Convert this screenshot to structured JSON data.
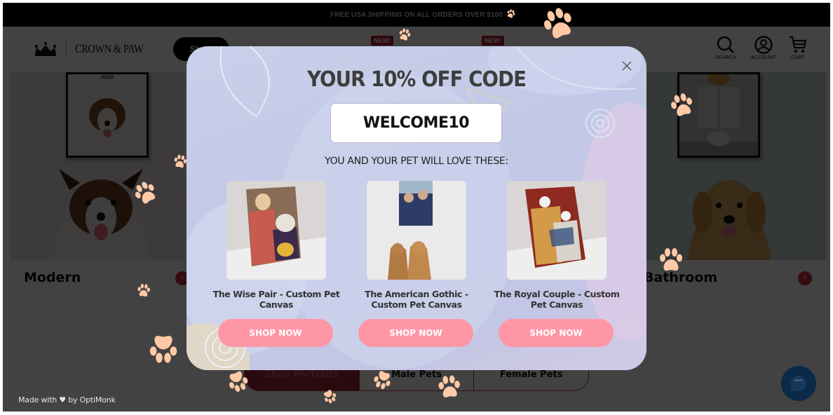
{
  "announcement": "FREE USA SHIPPING ON ALL ORDERS OVER $100",
  "brand": {
    "name": "CROWN & PAW"
  },
  "header": {
    "shop_button": "Sh",
    "badges": [
      "NEW!",
      "NEW!"
    ],
    "icons": [
      {
        "icon": "search-icon",
        "label": "SEARCH"
      },
      {
        "icon": "account-icon",
        "label": "ACCOUNT"
      },
      {
        "icon": "cart-icon",
        "label": "CART"
      }
    ]
  },
  "categories": [
    {
      "title": "Modern",
      "pet_name": "BENJI"
    },
    {
      "title": "Bathroom"
    }
  ],
  "tabs": [
    {
      "label": "Shop Portraits",
      "active": true
    },
    {
      "label": "Male Pets",
      "active": false
    },
    {
      "label": "Female Pets",
      "active": false
    }
  ],
  "popup": {
    "title": "YOUR 10% OFF CODE",
    "code": "WELCOME10",
    "subtitle": "YOU AND YOUR PET WILL LOVE THESE:",
    "products": [
      {
        "name": "The Wise Pair - Custom Pet Canvas",
        "button": "SHOP NOW"
      },
      {
        "name": "The American Gothic - Custom Pet Canvas",
        "button": "SHOP NOW"
      },
      {
        "name": "The Royal Couple - Custom Pet Canvas",
        "button": "SHOP NOW"
      }
    ],
    "close_icon": "close-icon"
  },
  "footer": {
    "made_with": "Made with ♥ by OptiMonk"
  },
  "chat": {
    "icon": "chat-icon",
    "glyph": "···"
  },
  "colors": {
    "accent_pink": "#ff96a6",
    "popup_bg": "#c3c9e6",
    "paw": "#ffc9a6",
    "brand_red": "#d52c3f",
    "chat_navy": "#0b2a48"
  }
}
